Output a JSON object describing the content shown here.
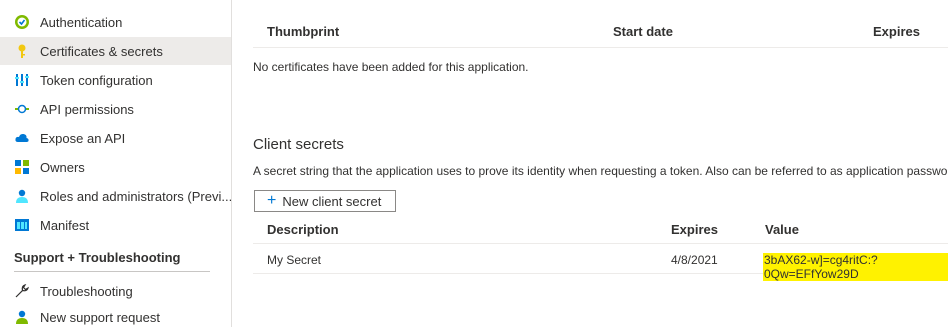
{
  "sidebar": {
    "items": [
      {
        "label": "Authentication",
        "icon": "authentication-icon"
      },
      {
        "label": "Certificates & secrets",
        "icon": "key-icon",
        "active": true
      },
      {
        "label": "Token configuration",
        "icon": "token-config-icon"
      },
      {
        "label": "API permissions",
        "icon": "api-permissions-icon"
      },
      {
        "label": "Expose an API",
        "icon": "cloud-icon"
      },
      {
        "label": "Owners",
        "icon": "owners-icon"
      },
      {
        "label": "Roles and administrators (Previ...",
        "icon": "roles-icon"
      },
      {
        "label": "Manifest",
        "icon": "manifest-icon"
      }
    ],
    "section_title": "Support + Troubleshooting",
    "support_items": [
      {
        "label": "Troubleshooting",
        "icon": "wrench-icon"
      },
      {
        "label": "New support request",
        "icon": "support-person-icon"
      }
    ]
  },
  "certificates": {
    "columns": [
      "Thumbprint",
      "Start date",
      "Expires"
    ],
    "empty_message": "No certificates have been added for this application."
  },
  "client_secrets": {
    "title": "Client secrets",
    "description": "A secret string that the application uses to prove its identity when requesting a token. Also can be referred to as application password.",
    "new_button": "New client secret",
    "new_button_icon": "plus-icon",
    "columns": [
      "Description",
      "Expires",
      "Value"
    ],
    "rows": [
      {
        "description": "My Secret",
        "expires": "4/8/2021",
        "value": "3bAX62-w]=cg4ritC:?0Qw=EFfYow29D"
      }
    ]
  },
  "colors": {
    "accent": "#0078d4",
    "active_bg": "#edebe9",
    "highlight": "#fff200"
  }
}
